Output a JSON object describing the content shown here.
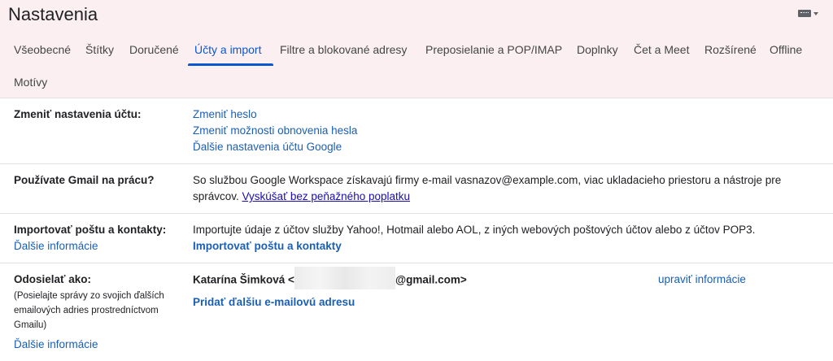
{
  "header": {
    "title": "Nastavenia",
    "keyboard_icon": "keyboard-icon"
  },
  "tabs": [
    {
      "label": "Všeobecné"
    },
    {
      "label": "Štítky"
    },
    {
      "label": "Doručené"
    },
    {
      "label": "Účty a import",
      "active": true
    },
    {
      "label": "Filtre a blokované adresy"
    },
    {
      "label": "Preposielanie a POP/IMAP"
    },
    {
      "label": "Doplnky"
    },
    {
      "label": "Čet a Meet"
    },
    {
      "label": "Rozšírené"
    },
    {
      "label": "Offline"
    },
    {
      "label": "Motívy"
    }
  ],
  "sections": {
    "change_account": {
      "label": "Zmeniť nastavenia účtu:",
      "links": [
        "Zmeniť heslo",
        "Zmeniť možnosti obnovenia hesla",
        "Ďalšie nastavenia účtu Google"
      ]
    },
    "work": {
      "label": "Používate Gmail na prácu?",
      "text1": "So službou Google Workspace získavajú firmy e-mail vasnazov@example.com, viac ukladacieho priestoru a nástroje pre",
      "text2": "správcov.",
      "trial_link": "Vyskúšať bez peňažného poplatku"
    },
    "import": {
      "label": "Importovať poštu a kontakty:",
      "more_link": "Ďalšie informácie",
      "text": "Importujte údaje z účtov služby Yahoo!, Hotmail alebo AOL, z iných webových poštových účtov alebo z účtov POP3.",
      "action_link": "Importovať poštu a kontakty"
    },
    "send_as": {
      "label": "Odosielať ako:",
      "sub": "(Posielajte správy zo svojich ďalších emailových adries prostredníctvom Gmailu)",
      "more_link": "Ďalšie informácie",
      "name": "Katarína Šimková <",
      "email_suffix": "@gmail.com>",
      "edit_link": "upraviť informácie",
      "add_link": "Pridať ďalšiu e-mailovú adresu"
    }
  },
  "colors": {
    "accent": "#0b57d0",
    "link": "#1a5fb4",
    "header_bg": "#fbeff1"
  }
}
